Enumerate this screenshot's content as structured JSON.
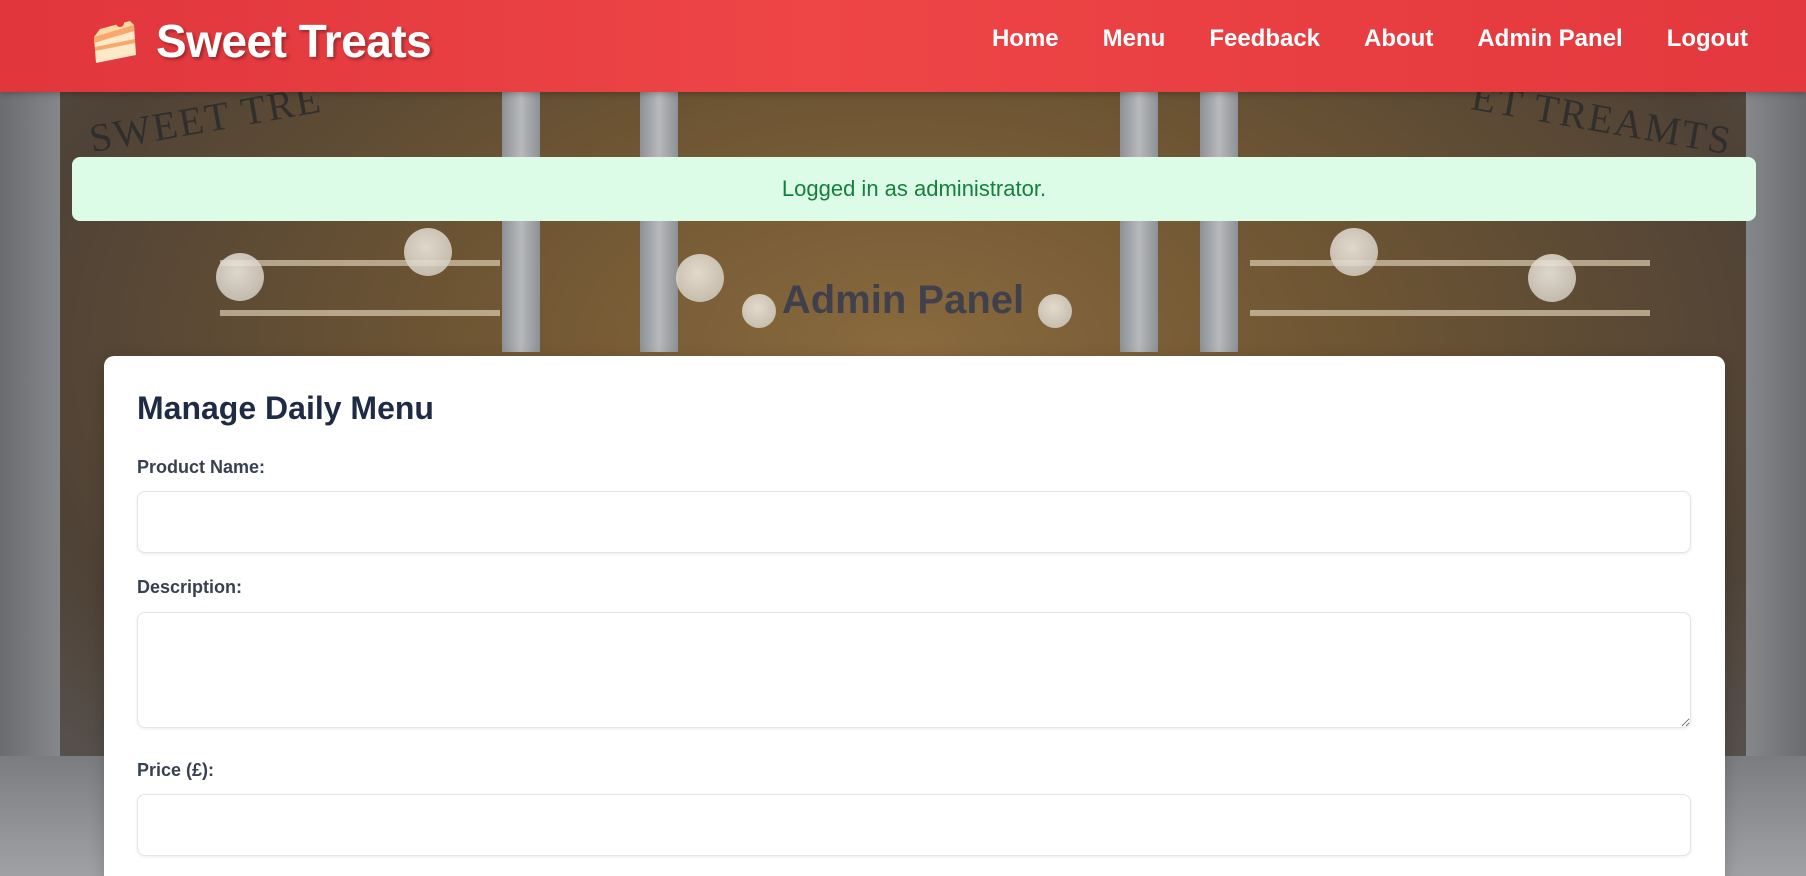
{
  "header": {
    "brand_name": "Sweet Treats",
    "brand_icon": "cake-slice-icon",
    "nav": [
      {
        "label": "Home"
      },
      {
        "label": "Menu"
      },
      {
        "label": "Feedback"
      },
      {
        "label": "About"
      },
      {
        "label": "Admin Panel"
      },
      {
        "label": "Logout"
      }
    ]
  },
  "alert": {
    "message": "Logged in as administrator."
  },
  "page": {
    "title": "Admin Panel"
  },
  "form": {
    "heading": "Manage Daily Menu",
    "product_name_label": "Product Name:",
    "product_name_value": "",
    "description_label": "Description:",
    "description_value": "",
    "price_label": "Price (£):",
    "price_value": ""
  },
  "colors": {
    "header_red": "#e83e40",
    "alert_bg": "#dcfce7",
    "alert_text": "#15803d",
    "heading_text": "#1f2a44"
  }
}
